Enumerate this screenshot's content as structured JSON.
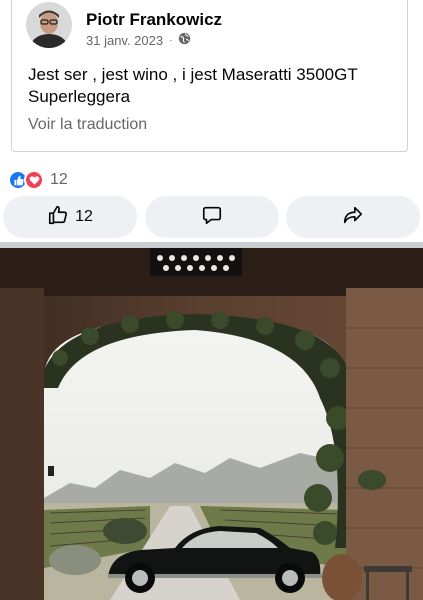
{
  "post": {
    "author": "Piotr Frankowicz",
    "date": "31 janv. 2023",
    "separator": "·",
    "audience_icon": "globe-icon",
    "text": "Jest ser , jest wino , i jest Maseratti 3500GT Superleggera",
    "translate_link": "Voir la traduction"
  },
  "reactions": {
    "icons": [
      "like-icon",
      "love-icon"
    ],
    "count": "12"
  },
  "actions": {
    "like_count": "12",
    "like_icon": "thumbs-up-icon",
    "comment_icon": "comment-icon",
    "share_icon": "share-icon"
  },
  "colors": {
    "like_blue": "#1877f2",
    "love_red": "#f33e58",
    "secondary_text": "#65676b",
    "button_bg": "#eef0f3"
  }
}
